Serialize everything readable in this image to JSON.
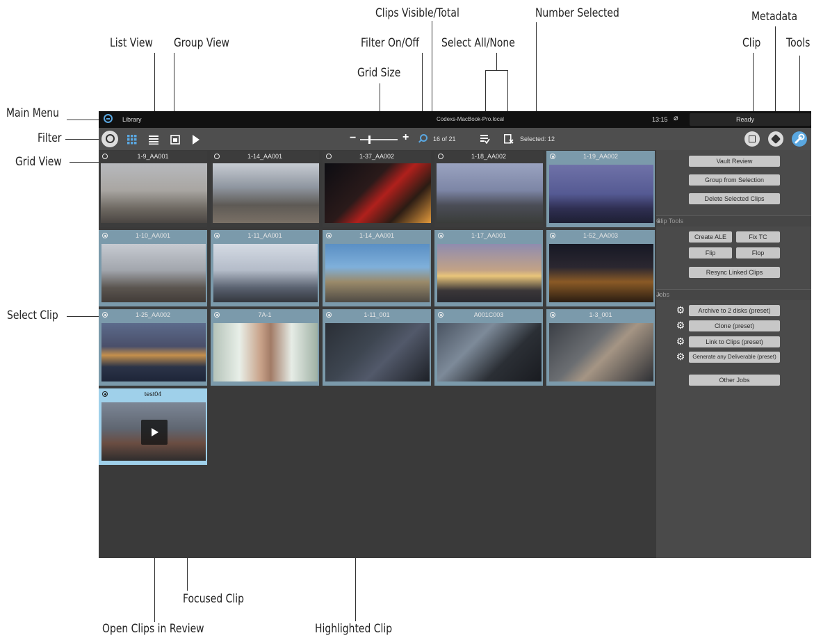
{
  "callouts": {
    "clips_visible_total": "Clips Visible/Total",
    "number_selected": "Number Selected",
    "metadata": "Metadata",
    "list_view": "List View",
    "group_view": "Group View",
    "filter_on_off": "Filter On/Off",
    "select_all_none": "Select All/None",
    "clip": "Clip",
    "tools": "Tools",
    "grid_size": "Grid Size",
    "main_menu": "Main Menu",
    "filter": "Filter",
    "grid_view": "Grid View",
    "select_clip": "Select Clip",
    "focused_clip": "Focused Clip",
    "open_clips_in_review": "Open Clips in Review",
    "highlighted_clip": "Highlighted Clip"
  },
  "topbar": {
    "title": "Library",
    "host": "Codexs-MacBook-Pro.local",
    "time": "13:15",
    "status": "Ready"
  },
  "toolbar": {
    "clip_count": "16 of 21",
    "selected": "Selected: 12",
    "zoom_minus": "−",
    "zoom_plus": "+"
  },
  "clips": [
    {
      "name": "1-9_AA001",
      "state": "normal",
      "scene": "bigben"
    },
    {
      "name": "1-14_AA001",
      "state": "normal",
      "scene": "walk"
    },
    {
      "name": "1-37_AA002",
      "state": "normal",
      "scene": "bus"
    },
    {
      "name": "1-18_AA002",
      "state": "normal",
      "scene": "stpauls"
    },
    {
      "name": "1-19_AA002",
      "state": "selected",
      "scene": "stpaulsnight"
    },
    {
      "name": "1-10_AA001",
      "state": "selected",
      "scene": "trees"
    },
    {
      "name": "1-11_AA001",
      "state": "selected",
      "scene": "eye"
    },
    {
      "name": "1-14_AA001",
      "state": "selected",
      "scene": "shoppers"
    },
    {
      "name": "1-17_AA001",
      "state": "selected",
      "scene": "westminster"
    },
    {
      "name": "1-52_AA003",
      "state": "selected",
      "scene": "church"
    },
    {
      "name": "1-25_AA002",
      "state": "selected",
      "scene": "river"
    },
    {
      "name": "7A-1",
      "state": "selected",
      "scene": "woman"
    },
    {
      "name": "1-11_001",
      "state": "selected",
      "scene": "car1"
    },
    {
      "name": "A001C003",
      "state": "selected",
      "scene": "car2"
    },
    {
      "name": "1-3_001",
      "state": "selected",
      "scene": "car3"
    },
    {
      "name": "test04",
      "state": "focused",
      "scene": "building"
    }
  ],
  "panel": {
    "vault_review": "Vault Review",
    "group_from_selection": "Group from Selection",
    "delete_selected": "Delete Selected Clips",
    "clip_tools_title": "Clip Tools",
    "create_ale": "Create ALE",
    "fix_tc": "Fix TC",
    "flip": "Flip",
    "flop": "Flop",
    "resync": "Resync Linked Clips",
    "jobs_title": "Jobs",
    "jobs": [
      "Archive to 2 disks (preset)",
      "Clone (preset)",
      "Link to Clips (preset)",
      "Generate any Deliverable (preset)"
    ],
    "other_jobs": "Other Jobs"
  },
  "colors": {
    "accent": "#5aa7e0",
    "selected_clip": "#7b9aab",
    "focused_clip": "#9fd0ea"
  }
}
